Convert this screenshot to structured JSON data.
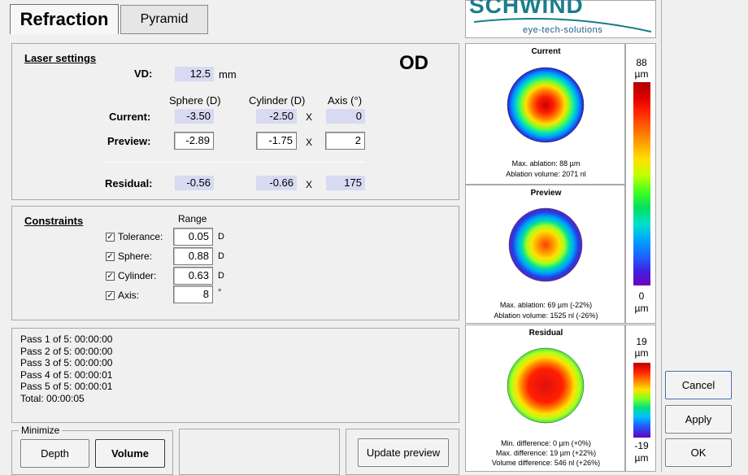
{
  "tabs": {
    "refraction": "Refraction",
    "pyramid": "Pyramid"
  },
  "logo": {
    "brand": "SCHWIND",
    "tagline": "eye-tech-solutions",
    "brand_color": "#1a7c8c"
  },
  "laser": {
    "title": "Laser settings",
    "eye": "OD",
    "vd_label": "VD:",
    "vd_value": "12.5",
    "vd_unit": "mm",
    "col_sphere": "Sphere (D)",
    "col_cylinder": "Cylinder (D)",
    "col_axis": "Axis (°)",
    "x_sep": "X",
    "rows": [
      {
        "label": "Current:",
        "sphere": "-3.50",
        "cylinder": "-2.50",
        "axis": "0"
      },
      {
        "label": "Preview:",
        "sphere": "-2.89",
        "cylinder": "-1.75",
        "axis": "2"
      },
      {
        "label": "Residual:",
        "sphere": "-0.56",
        "cylinder": "-0.66",
        "axis": "175"
      }
    ]
  },
  "constraints": {
    "title": "Constraints",
    "range_label": "Range",
    "items": [
      {
        "label": "Tolerance:",
        "value": "0.05",
        "unit": "D",
        "checked": "✓"
      },
      {
        "label": "Sphere:",
        "value": "0.88",
        "unit": "D",
        "checked": "✓"
      },
      {
        "label": "Cylinder:",
        "value": "0.63",
        "unit": "D",
        "checked": "✓"
      },
      {
        "label": "Axis:",
        "value": "8",
        "unit": "°",
        "checked": "✓"
      }
    ]
  },
  "log": {
    "lines": [
      "Pass 1 of 5: 00:00:00",
      "Pass 2 of 5: 00:00:00",
      "Pass 3 of 5: 00:00:00",
      "Pass 4 of 5: 00:00:01",
      "Pass 5 of 5: 00:00:01",
      "Total: 00:00:05"
    ]
  },
  "minimize": {
    "title": "Minimize",
    "depth": "Depth",
    "volume": "Volume"
  },
  "update_preview": "Update preview",
  "maps": {
    "current": {
      "title": "Current",
      "line1": "Max. ablation: 88 µm",
      "line2": "Ablation volume: 2071 nl"
    },
    "preview": {
      "title": "Preview",
      "line1": "Max. ablation: 69 µm (-22%)",
      "line2": "Ablation volume: 1525 nl (-26%)"
    },
    "residual": {
      "title": "Residual",
      "line1": "Min. difference: 0 µm (+0%)",
      "line2": "Max. difference: 19 µm (+22%)",
      "line3": "Volume difference: 546 nl (+26%)"
    }
  },
  "scales": {
    "top": {
      "max": "88",
      "min": "0",
      "unit": "µm"
    },
    "bottom": {
      "max": "19",
      "min": "-19",
      "unit": "µm"
    }
  },
  "buttons": {
    "cancel": "Cancel",
    "apply": "Apply",
    "ok": "OK"
  }
}
